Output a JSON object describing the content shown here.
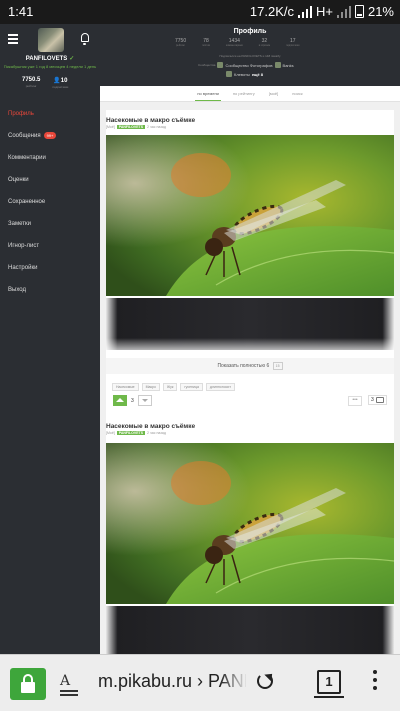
{
  "status_bar": {
    "time": "1:41",
    "network_speed": "17.2K/c",
    "network_type": "H+",
    "battery_percent": "21%"
  },
  "sidebar": {
    "username": "PANFILOVETS",
    "membership": "Пикабушник уже 1 год 8 месяцев 4 недели 1 день",
    "rating_value": "7750.5",
    "rating_label": "рейтинг",
    "subscribers_value": "10",
    "subscribers_label": "подписчики",
    "menu": [
      {
        "label": "Профиль",
        "active": true
      },
      {
        "label": "Сообщения",
        "badge": "99+"
      },
      {
        "label": "Комментарии"
      },
      {
        "label": "Оценки"
      },
      {
        "label": "Сохраненное"
      },
      {
        "label": "Заметки"
      },
      {
        "label": "Игнор-лист"
      },
      {
        "label": "Настройки"
      },
      {
        "label": "Выход"
      }
    ]
  },
  "profile": {
    "title": "Профиль",
    "counters": [
      {
        "value": "7750",
        "label": "рейтинг"
      },
      {
        "value": "78",
        "label": "постов"
      },
      {
        "value": "1434",
        "label": "комментариев"
      },
      {
        "value": "32",
        "label": "в горячем"
      },
      {
        "value": "17",
        "label": "подписчики"
      }
    ],
    "subscriptions_line": "Подписался на PANFILOVETS и 148 пикабу",
    "communities_label": "Сообщества",
    "communities": [
      "Сообщество Фотографов",
      "Banks"
    ],
    "communities_more_prefix": "Клевоты",
    "communities_more_suffix": "ещё 8"
  },
  "tabs": [
    {
      "label": "по времени",
      "active": true
    },
    {
      "label": "по рейтингу"
    },
    {
      "label": "[моё]"
    },
    {
      "label": "поиск"
    }
  ],
  "posts": [
    {
      "title": "Насекомые в макро съёмке",
      "meta_prefix": "[Моё]",
      "author": "PANFILOVETS",
      "time": "2 час назад",
      "show_full_label": "Показать полностью",
      "show_full_count": "6",
      "show_full_extra": "15",
      "tags": [
        "Насекомые",
        "Макро",
        "Жук",
        "гусеница",
        "длинноносит"
      ],
      "rating": "3",
      "comments_count": "3",
      "more_label": "•••"
    },
    {
      "title": "Насекомые в макро съёмке",
      "meta_prefix": "[Моё]",
      "author": "PANFILOVETS",
      "time": "2 час назад"
    }
  ],
  "browser": {
    "url": "m.pikabu.ru › PANFILOVETS",
    "tab_count": "1",
    "reader_icon_text": "A"
  },
  "colors": {
    "accent_green": "#6fb94a",
    "active_red": "#e8473a",
    "sidebar_bg": "#2b2e33",
    "lock_green": "#3ea63b"
  }
}
